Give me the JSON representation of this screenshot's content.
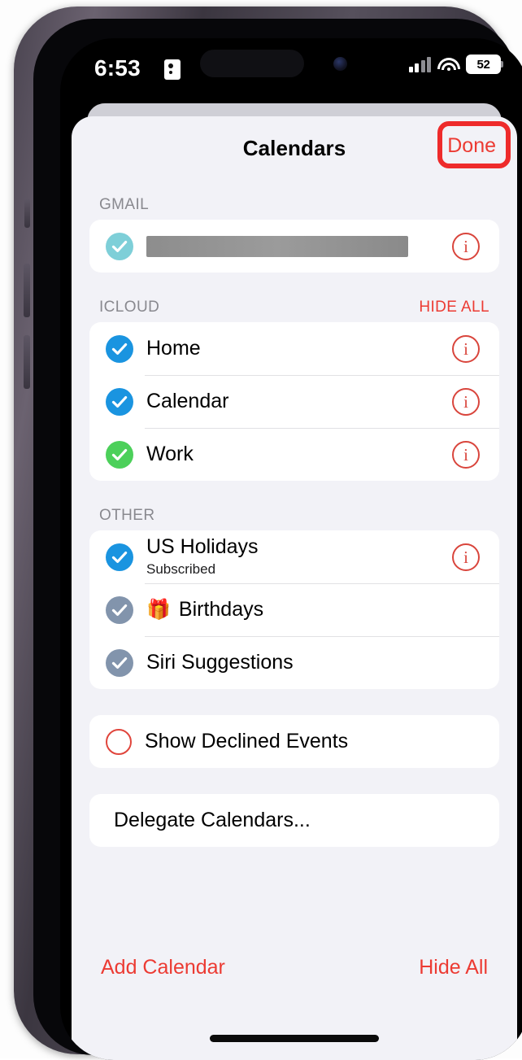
{
  "status_bar": {
    "time": "6:53",
    "lock_icon": "id-card-icon",
    "signal_icon": "cellular-bars-icon",
    "wifi_icon": "wifi-icon",
    "battery_level": "52"
  },
  "nav": {
    "title": "Calendars",
    "done_label": "Done",
    "highlight_color": "#ee2b2b"
  },
  "sections": [
    {
      "header": "GMAIL",
      "action": "",
      "rows": [
        {
          "title": "",
          "subtitle": "",
          "redacted": true,
          "check": "checked",
          "check_color": "#7ecfd8",
          "info": true,
          "gift": false
        }
      ]
    },
    {
      "header": "ICLOUD",
      "action": "HIDE ALL",
      "rows": [
        {
          "title": "Home",
          "subtitle": "",
          "redacted": false,
          "check": "checked",
          "check_color": "#1a94e0",
          "info": true,
          "gift": false
        },
        {
          "title": "Calendar",
          "subtitle": "",
          "redacted": false,
          "check": "checked",
          "check_color": "#1a94e0",
          "info": true,
          "gift": false
        },
        {
          "title": "Work",
          "subtitle": "",
          "redacted": false,
          "check": "checked",
          "check_color": "#4cd05a",
          "info": true,
          "gift": false
        }
      ]
    },
    {
      "header": "OTHER",
      "action": "",
      "rows": [
        {
          "title": "US Holidays",
          "subtitle": "Subscribed",
          "redacted": false,
          "check": "checked",
          "check_color": "#1a94e0",
          "info": true,
          "gift": false
        },
        {
          "title": "Birthdays",
          "subtitle": "",
          "redacted": false,
          "check": "checked",
          "check_color": "#8294ac",
          "info": false,
          "gift": true
        },
        {
          "title": "Siri Suggestions",
          "subtitle": "",
          "redacted": false,
          "check": "checked",
          "check_color": "#8294ac",
          "info": false,
          "gift": false
        }
      ]
    }
  ],
  "declined": {
    "label": "Show Declined Events",
    "check": "unchecked",
    "check_color": "#e0453c"
  },
  "delegate": {
    "label": "Delegate Calendars..."
  },
  "toolbar": {
    "add_label": "Add Calendar",
    "hide_label": "Hide All",
    "color": "#ec3b33"
  }
}
